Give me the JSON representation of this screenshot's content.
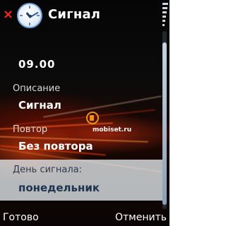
{
  "header": {
    "close_glyph": "×",
    "app_icon": "alarm-clock-icon",
    "title": "Сигнал"
  },
  "form": {
    "time_value": "09.00",
    "description_label": "Описание",
    "description_value": "Сигнал",
    "repeat_label": "Повтор",
    "repeat_value": "Без повтора",
    "day_label": "День сигнала:",
    "day_value": "понедельник"
  },
  "watermark": {
    "text": "mobiset.ru"
  },
  "softkeys": {
    "left": "Готово",
    "right": "Отменить"
  },
  "colors": {
    "close": "#ff2626",
    "watermark_accent": "#f09018",
    "selection_bg": "#e6ecf0"
  }
}
